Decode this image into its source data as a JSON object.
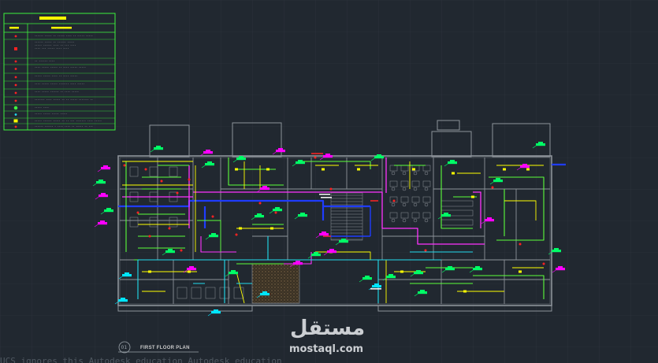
{
  "colors": {
    "background": "#212830",
    "grid": "#2b333c",
    "wall": "#8d939a",
    "legend_border": "#3df23d",
    "legend_title": "#ffff00",
    "tag_magenta": "#ff00ff",
    "tag_green": "#00ff66",
    "tag_cyan": "#00e5ff",
    "line_yellow": "#ffff00",
    "line_green": "#5cff3a",
    "line_magenta": "#ff33ff",
    "line_blue": "#1f3cff",
    "line_cyan": "#22ddee",
    "line_red": "#ff2222"
  },
  "legend": {
    "rows": [
      {
        "symbol": "red-dot",
        "text": "------ ----- -- ----- ---- -- -.-.- -----"
      },
      {
        "symbol": "red-square",
        "text": "------ ----- -- ------ -----\n----- ------ ---- -- --- ----\n---- --- ----- ---- ----"
      },
      {
        "symbol": "red-dot",
        "text": "-- ------ ----"
      },
      {
        "symbol": "red-dot",
        "text": "---- ----- ----- -- ---- ----- -----"
      },
      {
        "symbol": "red-dot",
        "text": "----- ----- ---- -- ---- -----"
      },
      {
        "symbol": "red-dot",
        "text": "---- ----- ----- ------- ---- -----"
      },
      {
        "symbol": "red-dot",
        "text": "---- ----- ------ -- ---- -----"
      },
      {
        "symbol": "red-dot",
        "text": "------- ---- ----- -- -- ----- ------- --"
      },
      {
        "symbol": "green-circle",
        "text": "----- ----"
      },
      {
        "symbol": "cyan-dot",
        "text": "----- ----- ----- -----"
      },
      {
        "symbol": "yellow-box",
        "text": "----- ------ ----- -- -- --- ------- ---- -----"
      },
      {
        "symbol": "red-dot",
        "text": "------ ------ - ---- ---- -- ----- -- ---"
      }
    ]
  },
  "title_block": {
    "number": "01",
    "title": "FIRST FLOOR PLAN"
  },
  "watermark": {
    "arabic": "مستقل",
    "latin": "mostaql.com"
  },
  "bottom_text": "UCS ignores this  Autodesk education  Autodesk education"
}
